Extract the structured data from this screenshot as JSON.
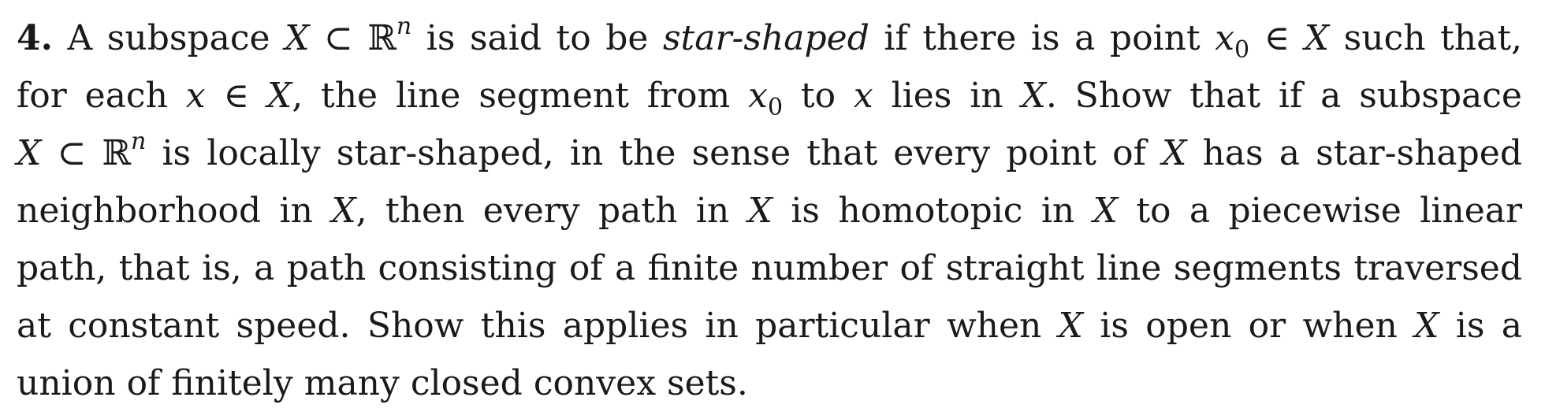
{
  "problem": {
    "number": "4.",
    "lines": [
      [
        {
          "t": " A subspace ",
          "s": "n"
        },
        {
          "t": "X",
          "s": "i"
        },
        {
          "t": " ⊂ ℝ",
          "s": "n"
        },
        {
          "t": "n",
          "s": "sup"
        },
        {
          "t": " is said to be ",
          "s": "n"
        },
        {
          "t": "star-shaped",
          "s": "i"
        },
        {
          "t": " if there is a point ",
          "s": "n"
        },
        {
          "t": "x",
          "s": "i"
        },
        {
          "t": "0",
          "s": "sub"
        },
        {
          "t": " ∈ ",
          "s": "n"
        },
        {
          "t": "X",
          "s": "i"
        },
        {
          "t": " such that,",
          "s": "n"
        }
      ],
      [
        {
          "t": "for each ",
          "s": "n"
        },
        {
          "t": "x",
          "s": "i"
        },
        {
          "t": " ∈ ",
          "s": "n"
        },
        {
          "t": "X",
          "s": "i"
        },
        {
          "t": ", the line segment from ",
          "s": "n"
        },
        {
          "t": "x",
          "s": "i"
        },
        {
          "t": "0",
          "s": "sub"
        },
        {
          "t": " to ",
          "s": "n"
        },
        {
          "t": "x",
          "s": "i"
        },
        {
          "t": " lies in ",
          "s": "n"
        },
        {
          "t": "X",
          "s": "i"
        },
        {
          "t": ".  Show that if a subspace",
          "s": "n"
        }
      ],
      [
        {
          "t": "X",
          "s": "i"
        },
        {
          "t": " ⊂ ℝ",
          "s": "n"
        },
        {
          "t": "n",
          "s": "sup"
        },
        {
          "t": " is locally star-shaped, in the sense that every point of ",
          "s": "n"
        },
        {
          "t": "X",
          "s": "i"
        },
        {
          "t": " has a star-shaped",
          "s": "n"
        }
      ],
      [
        {
          "t": "neighborhood in ",
          "s": "n"
        },
        {
          "t": "X",
          "s": "i"
        },
        {
          "t": ", then every path in ",
          "s": "n"
        },
        {
          "t": "X",
          "s": "i"
        },
        {
          "t": " is homotopic in ",
          "s": "n"
        },
        {
          "t": "X",
          "s": "i"
        },
        {
          "t": " to a piecewise linear",
          "s": "n"
        }
      ],
      [
        {
          "t": "path, that is, a path consisting of a finite number of straight line segments traversed",
          "s": "n"
        }
      ],
      [
        {
          "t": "at constant speed.  Show this applies in particular when ",
          "s": "n"
        },
        {
          "t": "X",
          "s": "i"
        },
        {
          "t": " is open or when ",
          "s": "n"
        },
        {
          "t": "X",
          "s": "i"
        },
        {
          "t": " is a",
          "s": "n"
        }
      ],
      [
        {
          "t": "union of finitely many closed convex sets.",
          "s": "n"
        }
      ]
    ]
  }
}
